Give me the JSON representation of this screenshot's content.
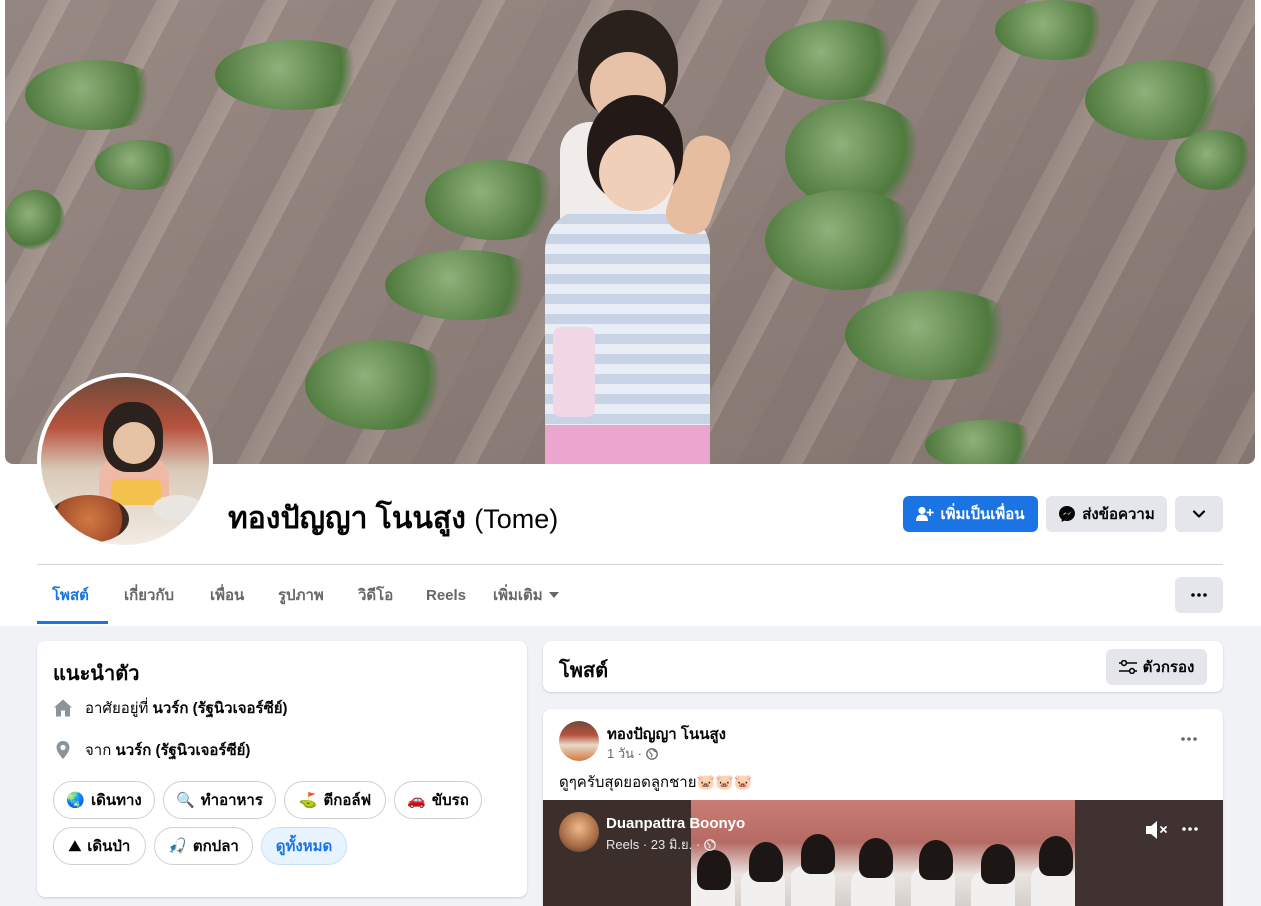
{
  "profile": {
    "name": "ทองปัญญา โนนสูง",
    "alt_name": "(Tome)"
  },
  "actions": {
    "add_friend": "เพิ่มเป็นเพื่อน",
    "message": "ส่งข้อความ"
  },
  "tabs": [
    {
      "label": "โพสต์"
    },
    {
      "label": "เกี่ยวกับ"
    },
    {
      "label": "เพื่อน"
    },
    {
      "label": "รูปภาพ"
    },
    {
      "label": "วิดีโอ"
    },
    {
      "label": "Reels"
    },
    {
      "label": "เพิ่มเติม"
    }
  ],
  "intro": {
    "title": "แนะนำตัว",
    "lives_prefix": "อาศัยอยู่ที่",
    "lives_place": "นวร์ก (รัฐนิวเจอร์ซีย์)",
    "from_prefix": "จาก",
    "from_place": "นวร์ก (รัฐนิวเจอร์ซีย์)",
    "hobbies": [
      {
        "icon": "🌏",
        "label": "เดินทาง"
      },
      {
        "icon": "🔍",
        "label": "ทำอาหาร"
      },
      {
        "icon": "⛳",
        "label": "ตีกอล์ฟ"
      },
      {
        "icon": "🚗",
        "label": "ขับรถ"
      },
      {
        "icon": "⛰",
        "label": "เดินป่า"
      },
      {
        "icon": "🎣",
        "label": "ตกปลา"
      }
    ],
    "see_all": "ดูทั้งหมด"
  },
  "posts": {
    "title": "โพสต์",
    "filter_label": "ตัวกรอง"
  },
  "post": {
    "author": "ทองปัญญา โนนสูง",
    "time": "1 วัน ·",
    "text": "ดูๆครับสุดยอดลูกชาย🐷🐷🐷",
    "shared": {
      "author": "Duanpattra Boonyo",
      "meta": "Reels · 23 มิ.ย. ·"
    }
  },
  "colors": {
    "accent": "#1b74e4",
    "page_bg": "#f0f2f5",
    "button_grey": "#e4e6eb"
  }
}
